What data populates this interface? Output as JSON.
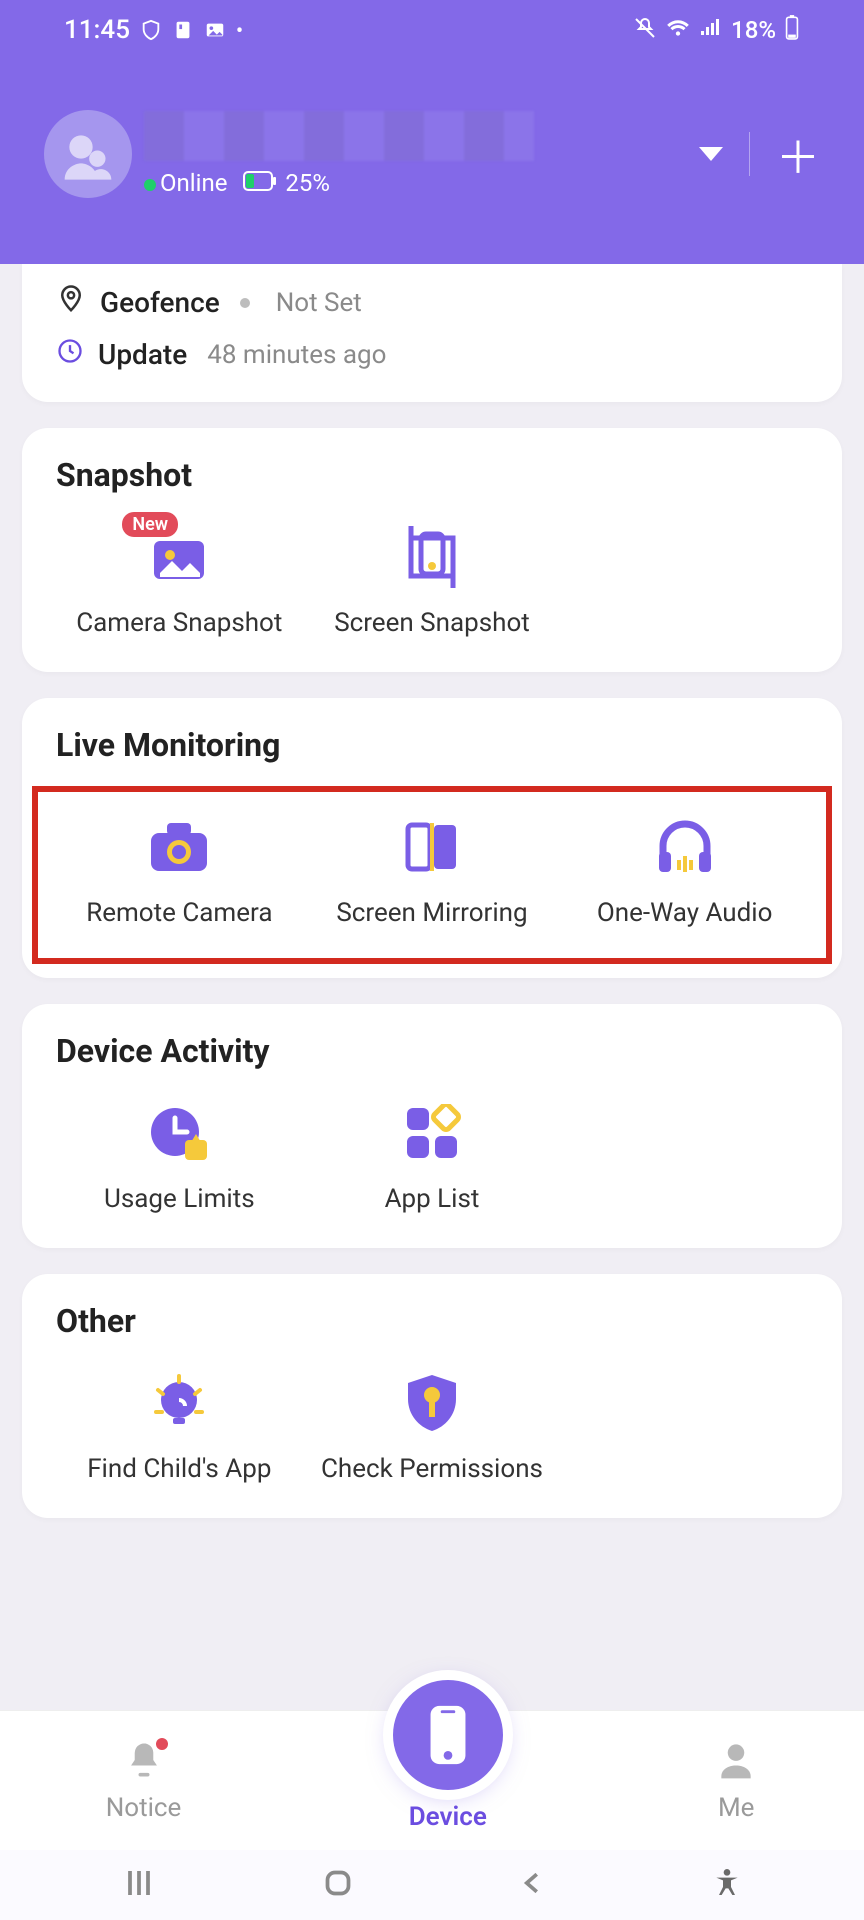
{
  "status": {
    "time": "11:45",
    "battery": "18%"
  },
  "header": {
    "status_label": "Online",
    "device_battery": "25%"
  },
  "info": {
    "geofence_label": "Geofence",
    "geofence_value": "Not Set",
    "update_label": "Update",
    "update_value": "48 minutes ago"
  },
  "snapshot": {
    "title": "Snapshot",
    "camera": "Camera Snapshot",
    "camera_badge": "New",
    "screen": "Screen Snapshot"
  },
  "live": {
    "title": "Live Monitoring",
    "remote": "Remote Camera",
    "mirror": "Screen Mirroring",
    "audio": "One-Way Audio"
  },
  "activity": {
    "title": "Device Activity",
    "limits": "Usage Limits",
    "apps": "App List"
  },
  "other": {
    "title": "Other",
    "find": "Find Child's App",
    "perm": "Check Permissions"
  },
  "nav": {
    "notice": "Notice",
    "device": "Device",
    "me": "Me"
  }
}
